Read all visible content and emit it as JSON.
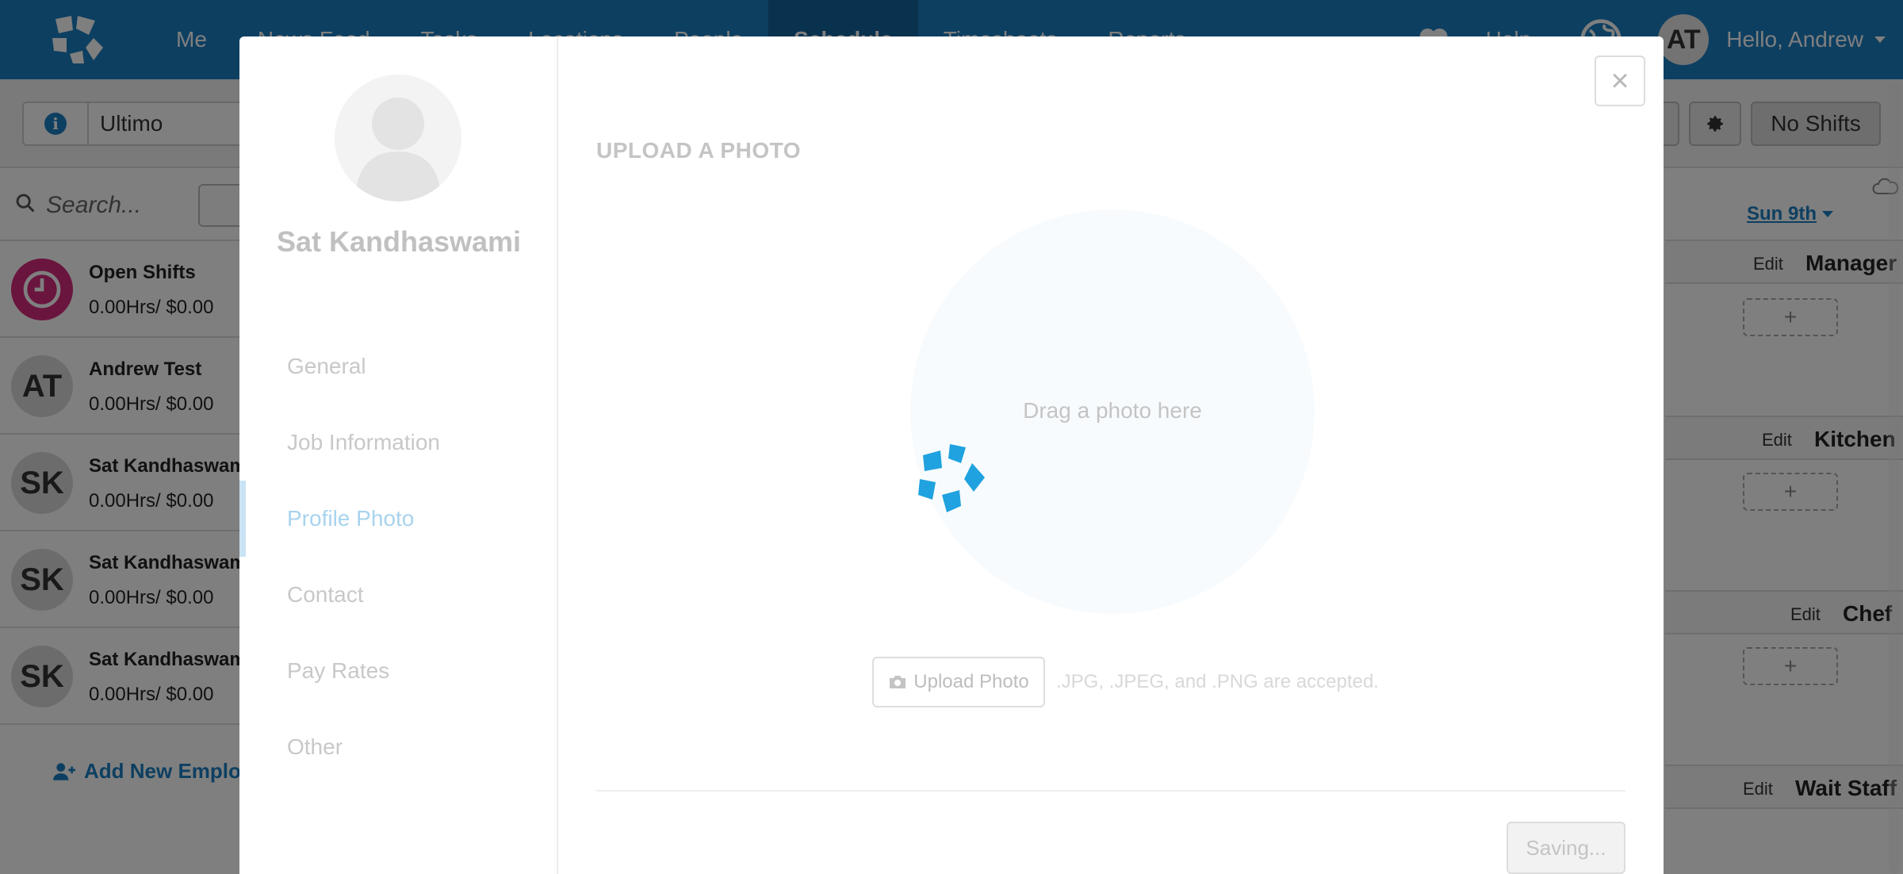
{
  "nav": {
    "items": [
      {
        "label": "Me",
        "active": false
      },
      {
        "label": "News Feed",
        "active": false
      },
      {
        "label": "Tasks",
        "active": false
      },
      {
        "label": "Locations",
        "active": false
      },
      {
        "label": "People",
        "active": false
      },
      {
        "label": "Schedule",
        "active": true
      },
      {
        "label": "Timesheets",
        "active": false
      },
      {
        "label": "Reports",
        "active": false
      }
    ],
    "help_label": "Help",
    "user_initials": "AT",
    "greeting": "Hello, Andrew"
  },
  "toolbar": {
    "location": "Ultimo",
    "no_shifts_label": "No Shifts"
  },
  "sidebar": {
    "search_placeholder": "Search...",
    "employees": [
      {
        "initials": "",
        "name": "Open Shifts",
        "hours": "0.00Hrs/ $0.00",
        "open": true
      },
      {
        "initials": "AT",
        "name": "Andrew Test",
        "hours": "0.00Hrs/ $0.00",
        "open": false
      },
      {
        "initials": "SK",
        "name": "Sat Kandhaswami",
        "hours": "0.00Hrs/ $0.00",
        "open": false
      },
      {
        "initials": "SK",
        "name": "Sat Kandhaswami",
        "hours": "0.00Hrs/ $0.00",
        "open": false
      },
      {
        "initials": "SK",
        "name": "Sat Kandhaswami",
        "hours": "0.00Hrs/ $0.00",
        "open": false
      }
    ],
    "add_employee_label": "Add New Employee"
  },
  "schedule": {
    "day_label": "Sun 9th",
    "edit_label": "Edit",
    "roles": [
      "Manager",
      "Kitchen",
      "Chef",
      "Wait Staff"
    ],
    "add_shift_symbol": "+"
  },
  "modal": {
    "profile_name": "Sat Kandhaswami",
    "menu": [
      {
        "label": "General",
        "active": false
      },
      {
        "label": "Job Information",
        "active": false
      },
      {
        "label": "Profile Photo",
        "active": true
      },
      {
        "label": "Contact",
        "active": false
      },
      {
        "label": "Pay Rates",
        "active": false
      },
      {
        "label": "Other",
        "active": false
      }
    ],
    "section_title": "UPLOAD A PHOTO",
    "drop_text": "Drag a photo here",
    "upload_button_label": "Upload Photo",
    "accepted_text": ".JPG, .JPEG, and .PNG are accepted.",
    "saving_label": "Saving...",
    "close_symbol": "×"
  },
  "colors": {
    "brand_blue": "#1a7ec2",
    "nav_active": "#13649c",
    "open_shift_pink": "#d52a7c"
  }
}
